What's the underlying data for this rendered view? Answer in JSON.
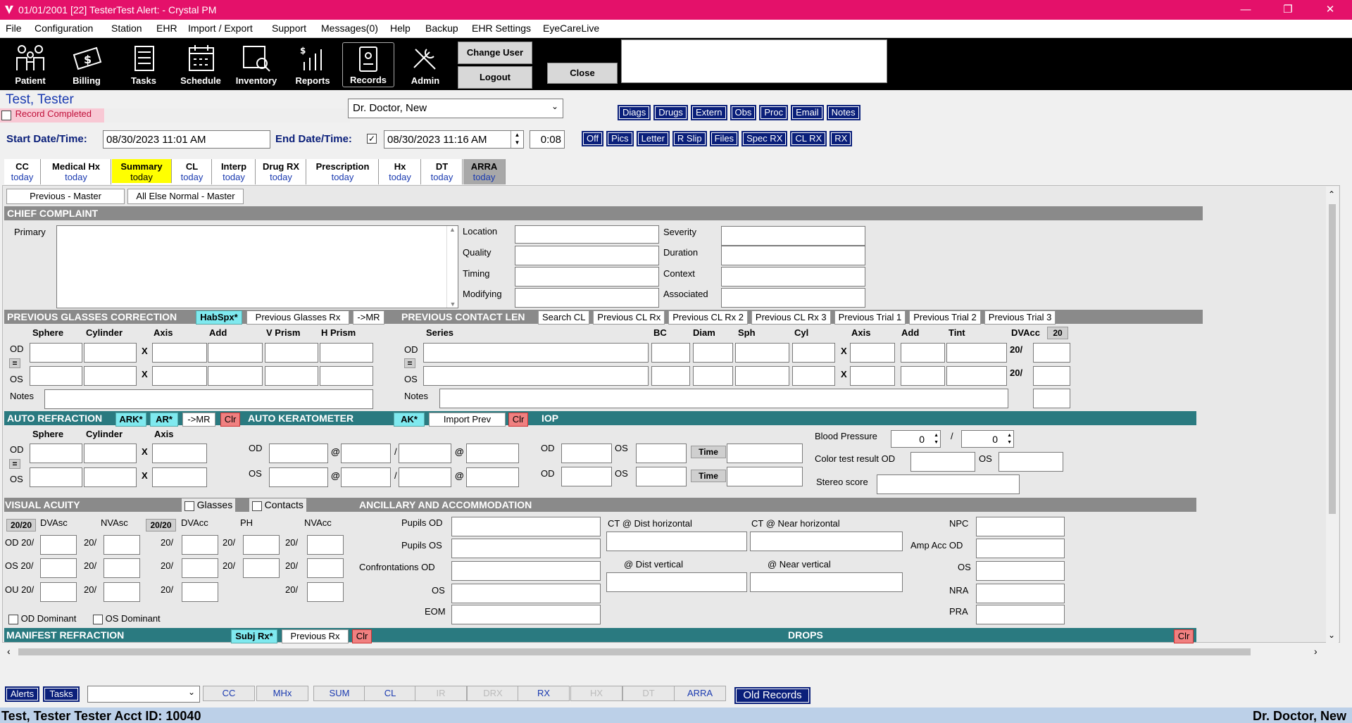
{
  "window": {
    "title": "01/01/2001 [22] TesterTest Alert:  - Crystal PM"
  },
  "menu": [
    "File",
    "Configuration",
    "Station",
    "EHR",
    "Import / Export",
    "Support",
    "Messages(0)",
    "Help",
    "Backup",
    "EHR Settings",
    "EyeCareLive"
  ],
  "toolbar": {
    "patient": "Patient",
    "billing": "Billing",
    "tasks": "Tasks",
    "schedule": "Schedule",
    "inventory": "Inventory",
    "reports": "Reports",
    "records": "Records",
    "admin": "Admin",
    "change_user": "Change User",
    "logout": "Logout",
    "close": "Close"
  },
  "patient": {
    "name": "Test, Tester",
    "record_completed": "Record Completed",
    "doctor": "Dr. Doctor, New",
    "start_label": "Start Date/Time:",
    "start_value": "08/30/2023 11:01 AM",
    "end_label": "End Date/Time:",
    "end_value": "08/30/2023 11:16 AM",
    "duration": "0:08"
  },
  "quick_buttons_row1": [
    "Diags",
    "Drugs",
    "Extern",
    "Obs",
    "Proc",
    "Email",
    "Notes"
  ],
  "quick_buttons_row2": [
    "Off",
    "Pics",
    "Letter",
    "R Slip",
    "Files",
    "Spec RX",
    "CL RX",
    "RX"
  ],
  "tabs": [
    {
      "label": "CC",
      "sub": "today"
    },
    {
      "label": "Medical Hx",
      "sub": "today"
    },
    {
      "label": "Summary",
      "sub": "today"
    },
    {
      "label": "CL",
      "sub": "today"
    },
    {
      "label": "Interp",
      "sub": "today"
    },
    {
      "label": "Drug RX",
      "sub": "today"
    },
    {
      "label": "Prescription",
      "sub": "today"
    },
    {
      "label": "Hx",
      "sub": "today"
    },
    {
      "label": "DT",
      "sub": "today"
    },
    {
      "label": "ARRA",
      "sub": "today"
    }
  ],
  "summary": {
    "previous_master": "Previous - Master",
    "all_else_normal": "All Else Normal - Master",
    "chief_complaint": "CHIEF COMPLAINT",
    "primary": "Primary",
    "cc_fields_left": [
      "Location",
      "Quality",
      "Timing",
      "Modifying"
    ],
    "cc_fields_right": [
      "Severity",
      "Duration",
      "Context",
      "Associated"
    ],
    "prev_glasses": "PREVIOUS GLASSES CORRECTION",
    "habspx": "HabSpx*",
    "prev_glasses_rx": "Previous Glasses Rx",
    "to_mr": "->MR",
    "prev_contact": "PREVIOUS CONTACT LEN",
    "cl_buttons": [
      "Search CL",
      "Previous CL Rx",
      "Previous CL Rx 2",
      "Previous CL Rx 3",
      "Previous Trial 1",
      "Previous Trial 2",
      "Previous Trial 3"
    ],
    "glasses_cols": [
      "Sphere",
      "Cylinder",
      "Axis",
      "Add",
      "V Prism",
      "H Prism"
    ],
    "cl_cols": [
      "Series",
      "BC",
      "Diam",
      "Sph",
      "Cyl",
      "Axis",
      "Add",
      "Tint",
      "DVAcc"
    ],
    "dvacc_badge": "20",
    "od": "OD",
    "os": "OS",
    "ou": "OU",
    "x": "X",
    "notes": "Notes",
    "eq": "=",
    "twenty": "20/",
    "auto_refraction": "AUTO REFRACTION",
    "ark": "ARK*",
    "ar": "AR*",
    "clr": "Clr",
    "auto_keratometer": "AUTO KERATOMETER",
    "ak": "AK*",
    "import_prev": "Import Prev",
    "iop": "IOP",
    "time": "Time",
    "at": "@",
    "slash": "/",
    "ar_cols": [
      "Sphere",
      "Cylinder",
      "Axis"
    ],
    "blood_pressure": "Blood Pressure",
    "bp1": "0",
    "bp2": "0",
    "color_test": "Color test result OD",
    "stereo": "Stereo score",
    "visual_acuity": "VISUAL ACUITY",
    "glasses": "Glasses",
    "contacts": "Contacts",
    "ancillary": "ANCILLARY AND ACCOMMODATION",
    "va_cols": [
      "DVAsc",
      "NVAsc",
      "DVAcc",
      "PH",
      "NVAcc"
    ],
    "va_rows": [
      "OD 20/",
      "OS 20/",
      "OU 20/"
    ],
    "twenty_twenty": "20/20",
    "od_dominant": "OD Dominant",
    "os_dominant": "OS Dominant",
    "anc_left": [
      "Pupils OD",
      "Pupils OS",
      "Confrontations OD",
      "OS",
      "EOM"
    ],
    "ct_dist_h": "CT @ Dist horizontal",
    "ct_near_h": "CT @ Near horizontal",
    "dist_v": "@ Dist vertical",
    "near_v": "@ Near vertical",
    "anc_right": [
      "NPC",
      "Amp Acc OD",
      "OS",
      "NRA",
      "PRA"
    ],
    "manifest": "MANIFEST REFRACTION",
    "subj_rx": "Subj Rx*",
    "previous_rx": "Previous Rx",
    "drops": "DROPS"
  },
  "footer": {
    "alerts": "Alerts",
    "tasks": "Tasks",
    "tabs": [
      "CC",
      "MHx",
      "SUM",
      "CL",
      "IR",
      "DRX",
      "RX",
      "HX",
      "DT",
      "ARRA"
    ],
    "old_records": "Old Records"
  },
  "statusbar": {
    "left": "Test, Tester Tester Acct ID: 10040",
    "right": "Dr. Doctor, New"
  },
  "colors": {
    "titlebar": "#e4116a",
    "navy": "#0a1f7a",
    "teal": "#2a7a80",
    "highlight": "#ffff00"
  }
}
